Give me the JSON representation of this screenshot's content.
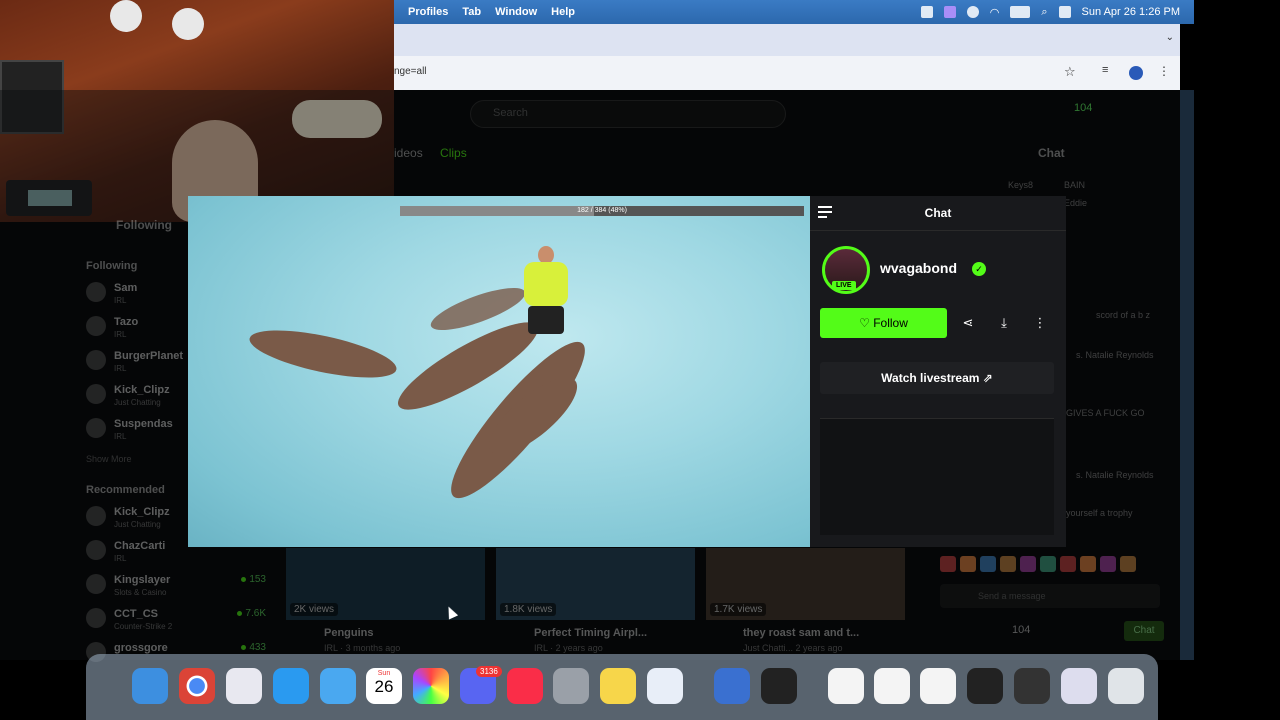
{
  "menubar": {
    "items": [
      "Profiles",
      "Tab",
      "Window",
      "Help"
    ],
    "datetime": "Sun Apr 26  1:26 PM"
  },
  "browser": {
    "url_fragment": "nge=all"
  },
  "site": {
    "search_placeholder": "Search",
    "top_count": "104",
    "tabs": [
      "ideos",
      "Clips"
    ],
    "sidebar_following_header_top": "Following",
    "sidebar_following_title": "Following",
    "following": [
      {
        "name": "Sam",
        "sub": "IRL"
      },
      {
        "name": "Tazo",
        "sub": "IRL"
      },
      {
        "name": "BurgerPlanet",
        "sub": "IRL"
      },
      {
        "name": "Kick_Clipz",
        "sub": "Just Chatting"
      },
      {
        "name": "Suspendas",
        "sub": "IRL"
      }
    ],
    "show_more": "Show More",
    "recommended_title": "Recommended",
    "recommended": [
      {
        "name": "Kick_Clipz",
        "sub": "Just Chatting",
        "count": ""
      },
      {
        "name": "ChazCarti",
        "sub": "IRL",
        "count": ""
      },
      {
        "name": "Kingslayer",
        "sub": "Slots & Casino",
        "count": "153"
      },
      {
        "name": "CCT_CS",
        "sub": "Counter-Strike 2",
        "count": "7.6K"
      },
      {
        "name": "grossgore",
        "sub": "",
        "count": "433"
      }
    ],
    "videos": [
      {
        "views": "2K views",
        "title": "Penguins",
        "sub": "IRL · 3 months ago"
      },
      {
        "views": "1.8K views",
        "title": "Perfect Timing Airpl...",
        "sub": "IRL · 2 years ago"
      },
      {
        "views": "1.7K views",
        "title": "they roast sam and t...",
        "sub": "Just Chatti... 2 years ago"
      }
    ],
    "right_chat": {
      "title": "Chat",
      "lines": [
        "Keys8",
        "BAIN",
        "Eddie",
        "scord of a b z",
        "s. Natalie Reynolds",
        "GIVES A FUCK GO",
        "s. Natalie Reynolds",
        "yourself a trophy"
      ],
      "send_placeholder": "Send a message",
      "viewer_count": "104",
      "chat_button": "Chat"
    }
  },
  "video_popup": {
    "progress_text": "182 / 384 (48%)",
    "progress_fraction": 0.48
  },
  "chat_popup": {
    "title": "Chat",
    "username": "wvagabond",
    "live_badge": "LIVE",
    "follow_label": "Follow",
    "watch_label": "Watch livestream"
  },
  "dock": {
    "calendar_month": "Sun",
    "calendar_day": "26",
    "discord_badge": "3136"
  },
  "colors": {
    "kick_green": "#53fc18",
    "panel_bg": "#18191c",
    "menubar_blue": "#2c68ad"
  }
}
